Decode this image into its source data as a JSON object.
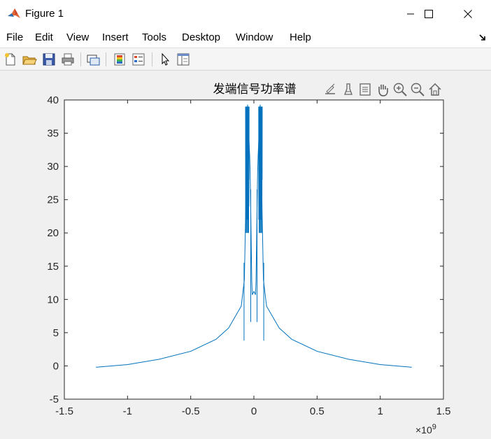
{
  "window": {
    "title": "Figure 1",
    "icon": "matlab-icon",
    "controls": [
      "minimize-icon",
      "maximize-icon",
      "close-icon"
    ]
  },
  "menu": {
    "items": [
      "File",
      "Edit",
      "View",
      "Insert",
      "Tools",
      "Desktop",
      "Window",
      "Help"
    ],
    "dock_icon": "dock-arrow-icon"
  },
  "toolbar": {
    "buttons": [
      "new-figure-icon",
      "open-file-icon",
      "save-icon",
      "print-icon",
      "link-plot-icon",
      "colorbar-icon",
      "legend-icon",
      "edit-plot-icon",
      "property-inspector-icon"
    ]
  },
  "axes_toolbar": {
    "buttons": [
      "export-icon",
      "brush-icon",
      "data-tips-icon",
      "pan-icon",
      "zoom-in-icon",
      "zoom-out-icon",
      "home-icon"
    ]
  },
  "colors": {
    "line": "#0072bd",
    "axes_bg": "#ffffff",
    "figure_bg": "#f0f0f0"
  },
  "chart_data": {
    "type": "line",
    "title": "发端信号功率谱",
    "xlabel": "",
    "ylabel": "",
    "xlim": [
      -1500000000.0,
      1500000000.0
    ],
    "ylim": [
      -5,
      40
    ],
    "x_exponent_label": "×10",
    "x_exponent_power": "9",
    "x_ticks": [
      -1500000000.0,
      -1000000000.0,
      -500000000.0,
      0,
      500000000.0,
      1000000000.0,
      1500000000.0
    ],
    "x_tick_labels": [
      "-1.5",
      "-1",
      "-0.5",
      "0",
      "0.5",
      "1",
      "1.5"
    ],
    "y_ticks": [
      -5,
      0,
      5,
      10,
      15,
      20,
      25,
      30,
      35,
      40
    ],
    "y_tick_labels": [
      "-5",
      "0",
      "5",
      "10",
      "15",
      "20",
      "25",
      "30",
      "35",
      "40"
    ],
    "grid": false,
    "series": [
      {
        "x_range": [
          -1250000000.0,
          1250000000.0
        ],
        "approx_points": [
          {
            "x": -1250000000.0,
            "y": -0.2
          },
          {
            "x": -1000000000.0,
            "y": 0.2
          },
          {
            "x": -750000000.0,
            "y": 1.0
          },
          {
            "x": -500000000.0,
            "y": 2.2
          },
          {
            "x": -300000000.0,
            "y": 4.0
          },
          {
            "x": -200000000.0,
            "y": 5.7
          },
          {
            "x": -100000000.0,
            "y": 9.0
          },
          {
            "x": -75000000.0,
            "y": 13.0
          },
          {
            "x": -50000000.0,
            "y": 39.3
          },
          {
            "x": -30000000.0,
            "y": 30.0
          },
          {
            "x": -15000000.0,
            "y": 10.6
          },
          {
            "x": 0.0,
            "y": 11.2
          },
          {
            "x": 15000000.0,
            "y": 10.6
          },
          {
            "x": 30000000.0,
            "y": 30.0
          },
          {
            "x": 50000000.0,
            "y": 39.3
          },
          {
            "x": 75000000.0,
            "y": 13.0
          },
          {
            "x": 100000000.0,
            "y": 9.0
          },
          {
            "x": 200000000.0,
            "y": 5.7
          },
          {
            "x": 300000000.0,
            "y": 4.0
          },
          {
            "x": 500000000.0,
            "y": 2.2
          },
          {
            "x": 750000000.0,
            "y": 1.0
          },
          {
            "x": 1000000000.0,
            "y": 0.2
          },
          {
            "x": 1250000000.0,
            "y": -0.2
          }
        ],
        "dip_lines": [
          {
            "x": -78000000.0,
            "y": 3.8
          },
          {
            "x": -25000000.0,
            "y": 6.6
          },
          {
            "x": 25000000.0,
            "y": 6.6
          },
          {
            "x": 78000000.0,
            "y": 3.8
          }
        ]
      }
    ]
  }
}
